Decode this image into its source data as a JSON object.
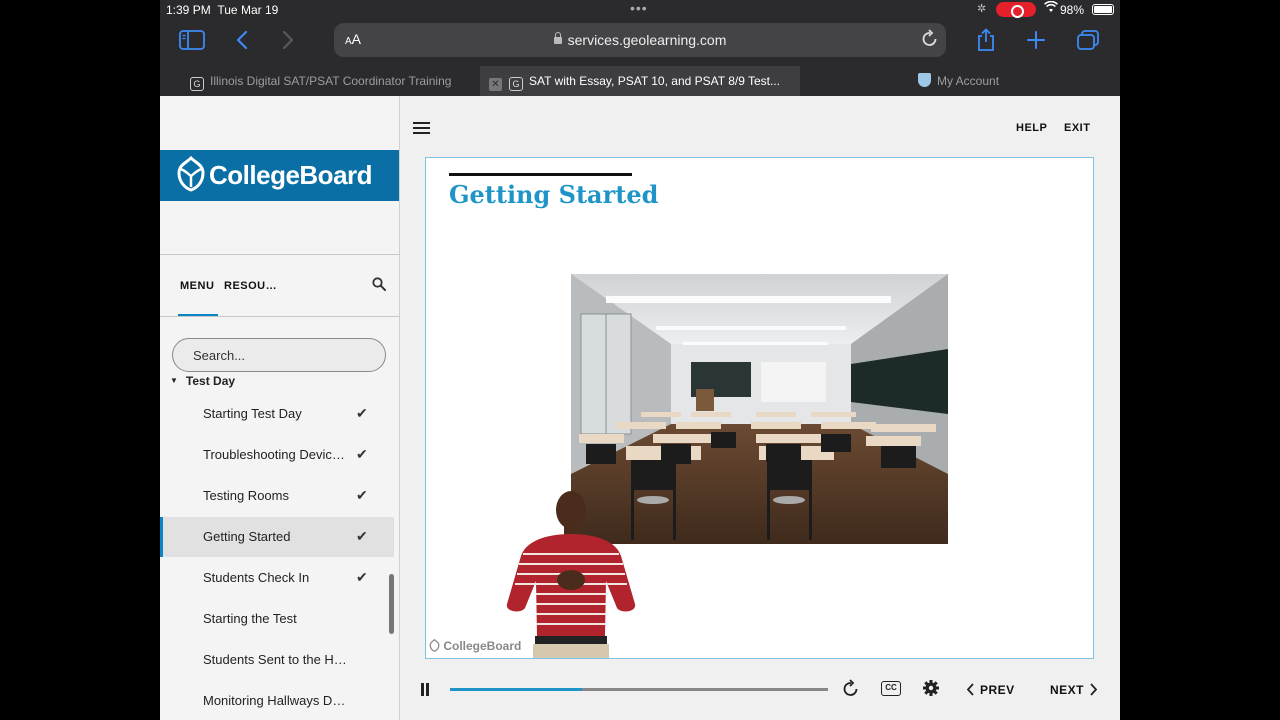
{
  "status_bar": {
    "time": "1:39 PM",
    "date": "Tue Mar 19",
    "battery": "98%"
  },
  "browser": {
    "address_size_label": "AA",
    "url": "services.geolearning.com",
    "tabs": [
      {
        "favicon": "G",
        "title": "Illinois Digital SAT/PSAT Coordinator Training",
        "active": false
      },
      {
        "favicon": "G",
        "title": "SAT with Essay, PSAT 10, and PSAT 8/9 Test...",
        "active": true
      },
      {
        "favicon": "shield",
        "title": "My Account",
        "active": false
      }
    ],
    "icons": [
      "sidebar-icon",
      "back-icon",
      "forward-icon",
      "reload-icon",
      "share-icon",
      "new-tab-icon",
      "tabs-overview-icon"
    ]
  },
  "sidebar": {
    "brand": "CollegeBoard",
    "tabs": [
      "MENU",
      "RESOU…"
    ],
    "search_placeholder": "Search...",
    "section": "Test Day",
    "items": [
      {
        "label": "Starting Test Day",
        "completed": true,
        "active": false
      },
      {
        "label": "Troubleshooting Devic…",
        "completed": true,
        "active": false
      },
      {
        "label": "Testing Rooms",
        "completed": true,
        "active": false
      },
      {
        "label": "Getting Started",
        "completed": true,
        "active": true
      },
      {
        "label": "Students Check In",
        "completed": true,
        "active": false
      },
      {
        "label": "Starting the Test",
        "completed": false,
        "active": false
      },
      {
        "label": "Students Sent to the H…",
        "completed": false,
        "active": false
      },
      {
        "label": "Monitoring Hallways D…",
        "completed": false,
        "active": false
      }
    ],
    "check_glyph": "✔"
  },
  "main": {
    "help": "HELP",
    "exit": "EXIT",
    "slide": {
      "title": "Getting Started",
      "footer_brand": "CollegeBoard"
    },
    "player": {
      "progress": 0.35,
      "prev": "PREV",
      "next": "NEXT",
      "cc": "CC"
    }
  },
  "colors": {
    "accent": "#1f95c7",
    "brand_banner": "#0a6fa4",
    "safari_blue": "#3d8af7"
  }
}
